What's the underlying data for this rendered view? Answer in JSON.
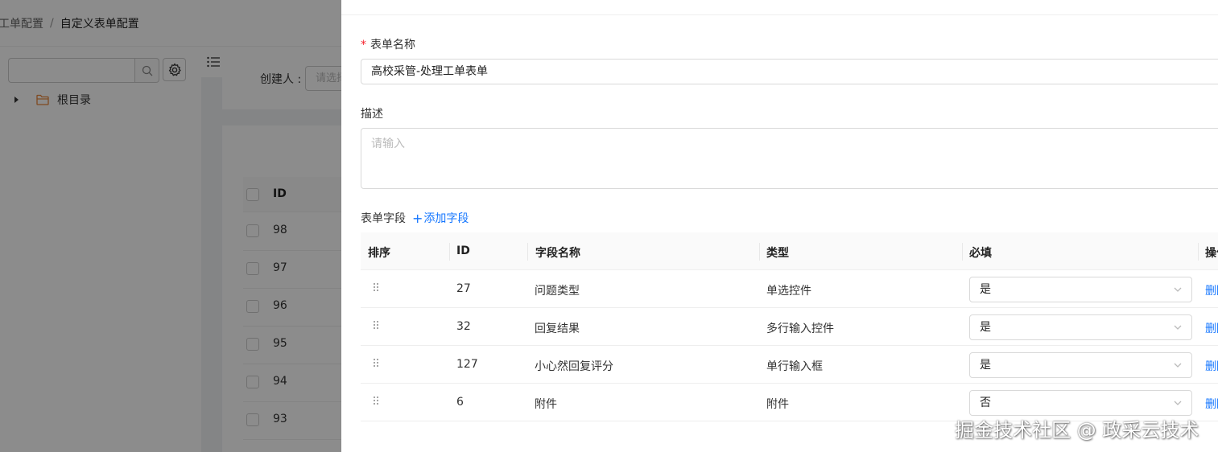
{
  "breadcrumb": {
    "item1": "工单配置",
    "separator": "/",
    "item2": "自定义表单配置"
  },
  "left_panel": {
    "search_placeholder": "",
    "search_icon": "search-icon",
    "settings_icon": "gear-icon",
    "tree": [
      {
        "label": "根目录",
        "icon": "folder-icon"
      }
    ]
  },
  "filter": {
    "creator_label": "创建人 :",
    "creator_placeholder": "请选择"
  },
  "bg_table": {
    "header": "ID",
    "rows": [
      "98",
      "97",
      "96",
      "95",
      "94",
      "93"
    ]
  },
  "drawer": {
    "name_label": "表单名称",
    "name_value": "高校采管-处理工单表单",
    "desc_label": "描述",
    "desc_placeholder": "请输入",
    "fields_label": "表单字段",
    "add_field_label": "添加字段",
    "table": {
      "headers": {
        "sort": "排序",
        "id": "ID",
        "name": "字段名称",
        "type": "类型",
        "required": "必填",
        "action": "操作"
      },
      "rows": [
        {
          "id": "27",
          "name": "问题类型",
          "type": "单选控件",
          "required": "是",
          "action": "删除"
        },
        {
          "id": "32",
          "name": "回复结果",
          "type": "多行输入控件",
          "required": "是",
          "action": "删除"
        },
        {
          "id": "127",
          "name": "小心然回复评分",
          "type": "单行输入框",
          "required": "是",
          "action": "删除"
        },
        {
          "id": "6",
          "name": "附件",
          "type": "附件",
          "required": "否",
          "action": "删除"
        }
      ]
    }
  },
  "watermark": "掘金技术社区 @ 政采云技术",
  "colors": {
    "accent": "#1677ff",
    "required_star": "#f5222d",
    "folder": "#e8833a"
  }
}
